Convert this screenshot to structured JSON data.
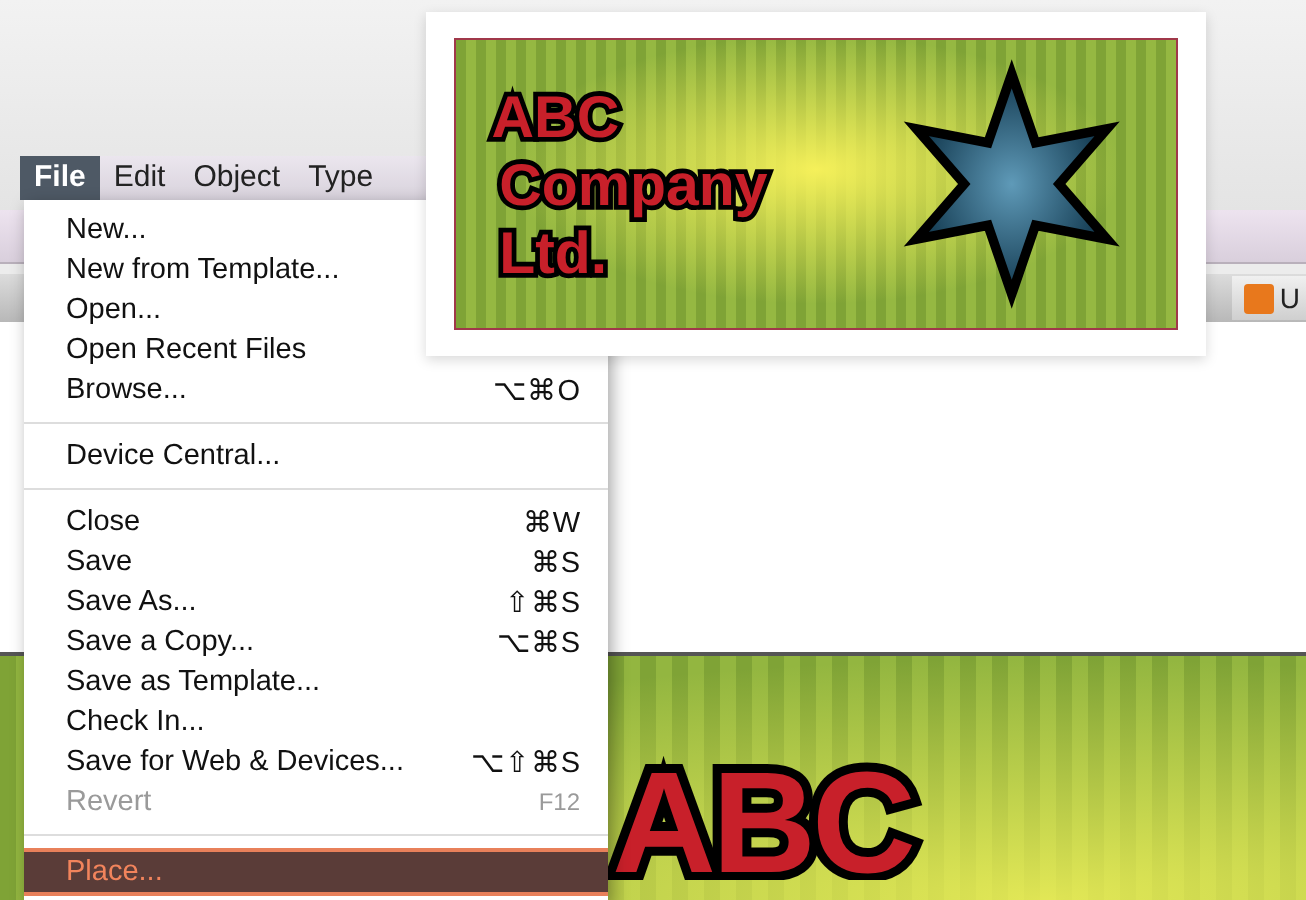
{
  "menubar": [
    {
      "label": "File",
      "selected": true
    },
    {
      "label": "Edit",
      "selected": false
    },
    {
      "label": "Object",
      "selected": false
    },
    {
      "label": "Type",
      "selected": false
    }
  ],
  "file_menu": {
    "groups": [
      [
        {
          "label": "New...",
          "disabled": false,
          "selected": false
        },
        {
          "label": "New from Template...",
          "disabled": false,
          "selected": false
        },
        {
          "label": "Open...",
          "disabled": false,
          "selected": false
        },
        {
          "label": "Open Recent Files",
          "disabled": false,
          "selected": false
        },
        {
          "label": "Browse...",
          "shortcut": "⌥⌘O",
          "disabled": false,
          "selected": false
        }
      ],
      [
        {
          "label": "Device Central...",
          "disabled": false,
          "selected": false
        }
      ],
      [
        {
          "label": "Close",
          "shortcut": "⌘W",
          "disabled": false,
          "selected": false
        },
        {
          "label": "Save",
          "shortcut": "⌘S",
          "disabled": false,
          "selected": false
        },
        {
          "label": "Save As...",
          "shortcut": "⇧⌘S",
          "disabled": false,
          "selected": false
        },
        {
          "label": "Save a Copy...",
          "shortcut": "⌥⌘S",
          "disabled": false,
          "selected": false
        },
        {
          "label": "Save as Template...",
          "disabled": false,
          "selected": false
        },
        {
          "label": "Check In...",
          "disabled": false,
          "selected": false
        },
        {
          "label": "Save for Web & Devices...",
          "shortcut": "⌥⇧⌘S",
          "disabled": false,
          "selected": false
        },
        {
          "label": "Revert",
          "shortcut": "F12",
          "disabled": true,
          "selected": false
        }
      ],
      [
        {
          "label": "Place...",
          "disabled": false,
          "selected": true
        }
      ]
    ]
  },
  "logo_preview": {
    "lines": [
      "ABC",
      "Company",
      "Ltd."
    ]
  },
  "document_tab": {
    "label": "U"
  },
  "artboard": {
    "text": "ABC"
  }
}
